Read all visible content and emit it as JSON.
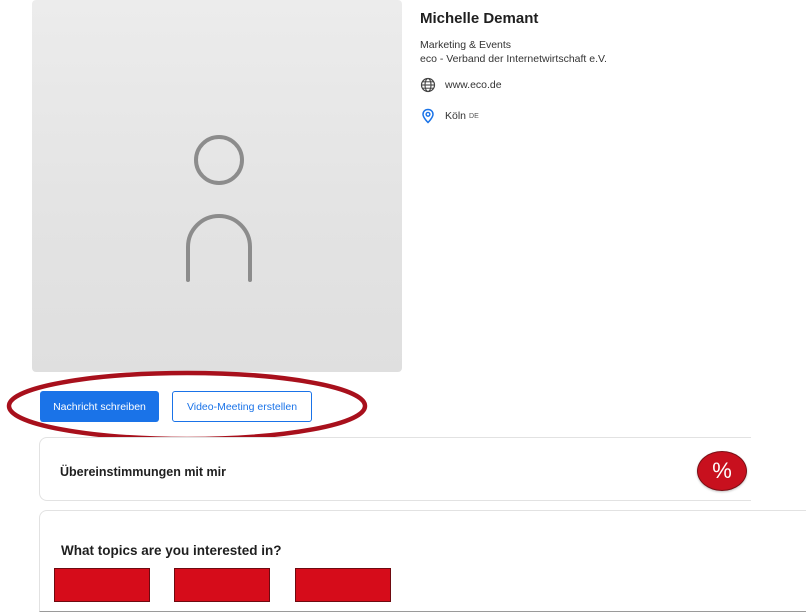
{
  "profile": {
    "name": "Michelle Demant",
    "role": "Marketing & Events",
    "organization": "eco - Verband der Internetwirtschaft e.V.",
    "website": "www.eco.de",
    "city": "Köln",
    "country": "DE",
    "avatar_icon": "person-placeholder-icon",
    "website_icon": "globe-icon",
    "location_icon": "location-pin-icon"
  },
  "actions": {
    "message_label": "Nachricht schreiben",
    "video_meeting_label": "Video-Meeting erstellen",
    "highlight_color": "#a8101c"
  },
  "matches": {
    "title": "Übereinstimmungen mit mir",
    "badge_symbol": "%",
    "badge_color": "#c8101e"
  },
  "topics": {
    "title": "What topics are you interested in?",
    "redacted_block_color": "#d60c1a",
    "items": [
      {
        "label": ""
      },
      {
        "label": ""
      },
      {
        "label": ""
      }
    ]
  },
  "colors": {
    "accent": "#1a73e8"
  }
}
